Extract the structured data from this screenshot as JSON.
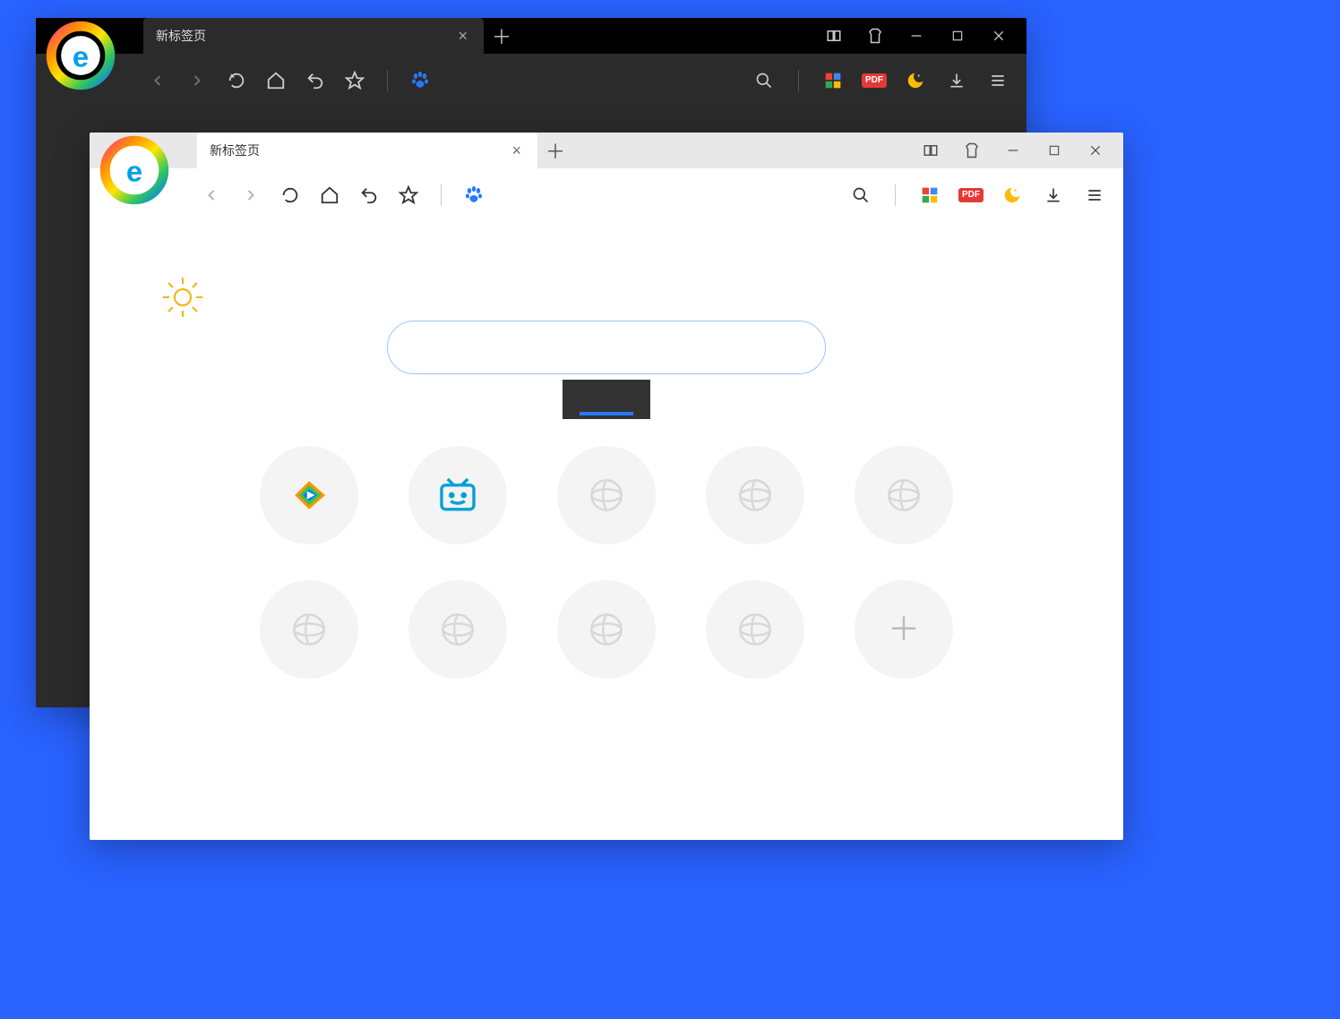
{
  "windows": {
    "dark": {
      "tabs": [
        {
          "title": "新标签页"
        }
      ]
    },
    "light": {
      "tabs": [
        {
          "title": "新标签页"
        }
      ]
    }
  },
  "toolbar": {
    "pdf_label": "PDF"
  },
  "newtab": {
    "search_placeholder": "",
    "dials": [
      {
        "kind": "app",
        "name": "tencent-video"
      },
      {
        "kind": "app",
        "name": "bilibili"
      },
      {
        "kind": "empty"
      },
      {
        "kind": "empty"
      },
      {
        "kind": "empty"
      },
      {
        "kind": "empty"
      },
      {
        "kind": "empty"
      },
      {
        "kind": "empty"
      },
      {
        "kind": "empty"
      },
      {
        "kind": "add"
      }
    ]
  }
}
